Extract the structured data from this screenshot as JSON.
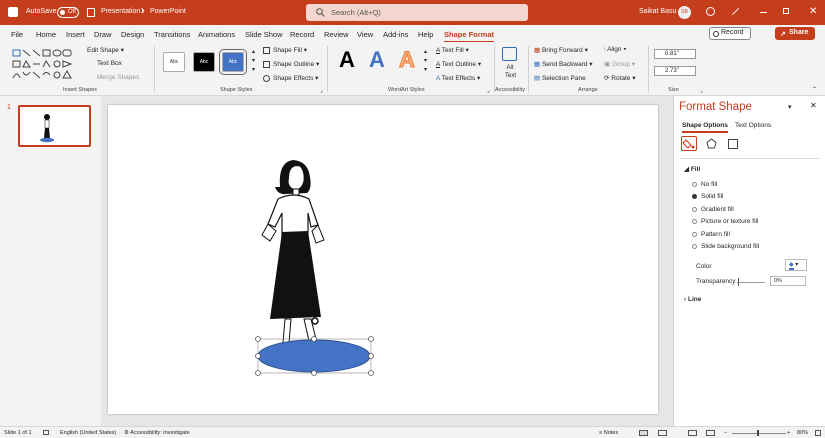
{
  "titlebar": {
    "autosave": "AutoSave",
    "toggle": "Off",
    "filename": "Presentation1",
    "separator": "•",
    "app": "PowerPoint",
    "user": "Saikat Basu",
    "user_initials": "SB"
  },
  "search": {
    "placeholder": "Search (Alt+Q)"
  },
  "menu": {
    "tabs": [
      "File",
      "Home",
      "Insert",
      "Draw",
      "Design",
      "Transitions",
      "Animations",
      "Slide Show",
      "Record",
      "Review",
      "View",
      "Add-ins",
      "Help",
      "Shape Format"
    ],
    "record": "Record",
    "share": "Share"
  },
  "ribbon": {
    "insert_shapes": {
      "edit_shape": "Edit Shape",
      "text_box": "Text Box",
      "merge_shapes": "Merge Shapes",
      "label": "Insert Shapes"
    },
    "shape_styles": {
      "swatches": [
        "Abc",
        "Abc",
        "Abc"
      ],
      "shape_fill": "Shape Fill",
      "shape_outline": "Shape Outline",
      "shape_effects": "Shape Effects",
      "label": "Shape Styles"
    },
    "wordart": {
      "letters": [
        "A",
        "A",
        "A"
      ],
      "text_fill": "Text Fill",
      "text_outline": "Text Outline",
      "text_effects": "Text Effects",
      "label": "WordArt Styles"
    },
    "accessibility": {
      "alt_text": "Alt Text",
      "label": "Accessibility"
    },
    "arrange": {
      "bring_forward": "Bring Forward",
      "send_backward": "Send Backward",
      "selection_pane": "Selection Pane",
      "align": "Align",
      "group": "Group",
      "rotate": "Rotate",
      "label": "Arrange"
    },
    "size": {
      "height": "0.81\"",
      "width": "2.73\"",
      "label": "Size"
    }
  },
  "slides": {
    "number": "1"
  },
  "format_pane": {
    "title": "Format Shape",
    "tabs": [
      "Shape Options",
      "Text Options"
    ],
    "fill_header": "Fill",
    "fill_options": [
      "No fill",
      "Solid fill",
      "Gradient fill",
      "Picture or texture fill",
      "Pattern fill",
      "Slide background fill"
    ],
    "selected_fill": "Solid fill",
    "color_label": "Color",
    "transparency_label": "Transparency",
    "transparency_value": "0%",
    "line_header": "Line"
  },
  "status": {
    "slide": "Slide 1 of 1",
    "language": "English (United States)",
    "accessibility": "Accessibility: Investigate",
    "notes": "Notes",
    "zoom": "80%"
  },
  "colors": {
    "accent": "#c43e1c",
    "ellipse": "#4472c4"
  }
}
